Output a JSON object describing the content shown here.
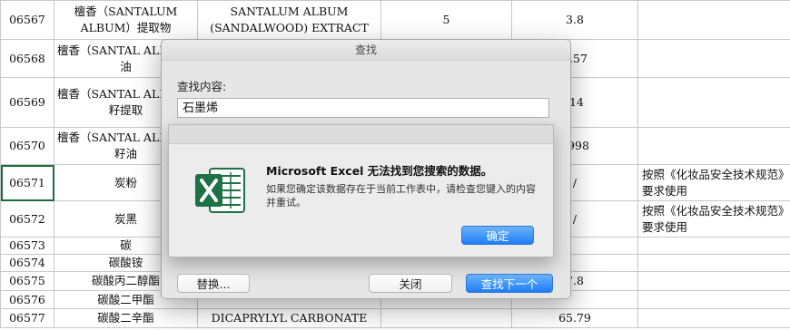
{
  "sheet": {
    "rows": [
      {
        "id": "06567",
        "zh": "檀香（SANTALUM ALBUM）提取物",
        "en": "SANTALUM ALBUM (SANDALWOOD) EXTRACT",
        "n1": "5",
        "n2": "3.8",
        "note": ""
      },
      {
        "id": "06568",
        "zh": "檀香（SANTAL ALBUM）油",
        "en": "",
        "n1": "",
        "n2": "2.57",
        "note": ""
      },
      {
        "id": "06569",
        "zh": "檀香（SANTAL ALBUM）籽提取",
        "en": "",
        "n1": "",
        "n2": ".14",
        "note": ""
      },
      {
        "id": "06570",
        "zh": "檀香（SANTAL ALBUM）籽油",
        "en": "",
        "n1": "",
        "n2": "9998",
        "note": ""
      },
      {
        "id": "06571",
        "zh": "炭粉",
        "en": "",
        "n1": "",
        "n2": "/",
        "note": "按照《化妆品安全技术规范》要求使用"
      },
      {
        "id": "06572",
        "zh": "炭黑",
        "en": "",
        "n1": "",
        "n2": "/",
        "note": "按照《化妆品安全技术规范》要求使用"
      },
      {
        "id": "06573",
        "zh": "碳",
        "en": "",
        "n1": "",
        "n2": "",
        "note": ""
      },
      {
        "id": "06574",
        "zh": "碳酸铵",
        "en": "",
        "n1": "",
        "n2": "",
        "note": ""
      },
      {
        "id": "06575",
        "zh": "碳酸丙二醇酯",
        "en": "",
        "n1": "",
        "n2": "7.8",
        "note": ""
      },
      {
        "id": "06576",
        "zh": "碳酸二甲酯",
        "en": "",
        "n1": "",
        "n2": "",
        "note": ""
      },
      {
        "id": "06577",
        "zh": "碳酸二辛酯",
        "en": "DICAPRYLYL CARBONATE",
        "n1": "",
        "n2": "65.79",
        "note": ""
      }
    ]
  },
  "find_dialog": {
    "title": "查找",
    "find_label": "查找内容:",
    "find_value": "石墨烯",
    "replace_button": "替换...",
    "close_button": "关闭",
    "find_next_button": "查找下一个"
  },
  "alert": {
    "title": "Microsoft Excel 无法找到您搜索的数据。",
    "message": "如果您确定该数据存在于当前工作表中，请检查您键入的内容并重试。",
    "ok_button": "确定",
    "icon": "excel-app-icon"
  },
  "colors": {
    "accent": "#1d7ef6",
    "excel_green": "#1e7145",
    "selection": "#1e6c3b"
  }
}
